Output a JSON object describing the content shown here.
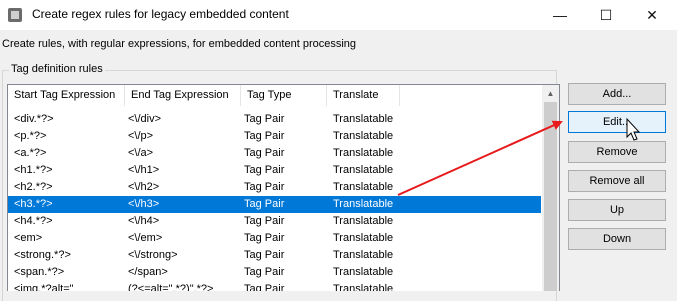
{
  "window": {
    "title": "Create regex rules for legacy embedded content",
    "minimize": "—",
    "maximize": "☐",
    "close": "✕"
  },
  "description": "Create rules, with regular expressions, for  embedded content processing",
  "group_label": "Tag definition rules",
  "columns": [
    "Start Tag Expression",
    "End Tag Expression",
    "Tag Type",
    "Translate"
  ],
  "rows": [
    [
      "<div.*?>",
      "<\\/div>",
      "Tag Pair",
      "Translatable"
    ],
    [
      "<p.*?>",
      "<\\/p>",
      "Tag Pair",
      "Translatable"
    ],
    [
      "<a.*?>",
      "<\\/a>",
      "Tag Pair",
      "Translatable"
    ],
    [
      "<h1.*?>",
      "<\\/h1>",
      "Tag Pair",
      "Translatable"
    ],
    [
      "<h2.*?>",
      "<\\/h2>",
      "Tag Pair",
      "Translatable"
    ],
    [
      "<h3.*?>",
      "<\\/h3>",
      "Tag Pair",
      "Translatable"
    ],
    [
      "<h4.*?>",
      "<\\/h4>",
      "Tag Pair",
      "Translatable"
    ],
    [
      "<em>",
      "<\\/em>",
      "Tag Pair",
      "Translatable"
    ],
    [
      "<strong.*?>",
      "<\\/strong>",
      "Tag Pair",
      "Translatable"
    ],
    [
      "<span.*?>",
      "</span>",
      "Tag Pair",
      "Translatable"
    ],
    [
      "<img.*?alt=\"",
      "(?<=alt=\".*?)\".*?>",
      "Tag Pair",
      "Translatable"
    ]
  ],
  "selected_row": 5,
  "buttons": {
    "add": "Add...",
    "edit": "Edit...",
    "remove": "Remove",
    "remove_all": "Remove all",
    "up": "Up",
    "down": "Down"
  },
  "colors": {
    "selection": "#0078d7",
    "annotation_arrow": "#e8191c"
  }
}
